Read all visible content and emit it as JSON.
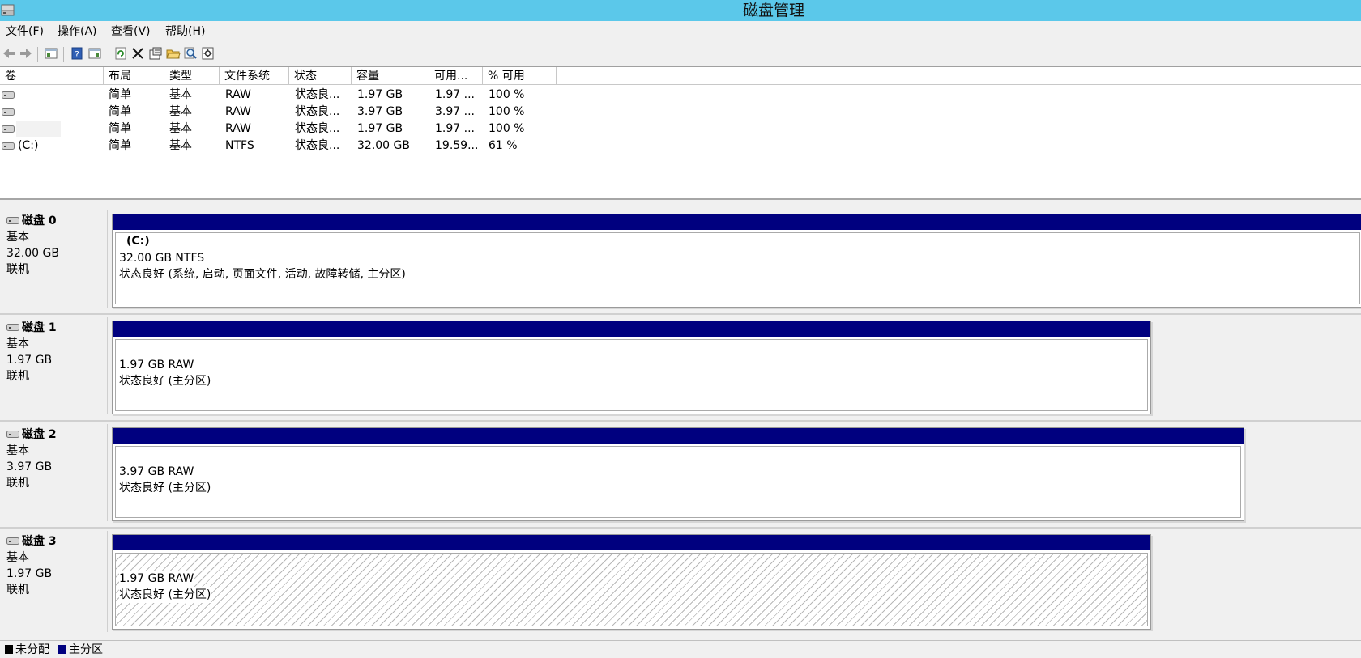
{
  "window": {
    "title": "磁盘管理"
  },
  "menu": {
    "items": [
      "文件(F)",
      "操作(A)",
      "查看(V)",
      "帮助(H)"
    ]
  },
  "toolbar": {
    "icons": [
      "back-arrow-icon",
      "forward-arrow-icon",
      "console-tree-icon",
      "help-icon",
      "properties-view-icon",
      "refresh-icon",
      "delete-icon",
      "properties-icon",
      "open-folder-icon",
      "search-icon",
      "settings-icon"
    ]
  },
  "volume_table": {
    "columns": [
      "卷",
      "布局",
      "类型",
      "文件系统",
      "状态",
      "容量",
      "可用...",
      "% 可用"
    ],
    "rows": [
      {
        "volume": "",
        "layout": "简单",
        "type": "基本",
        "fs": "RAW",
        "status": "状态良...",
        "capacity": "1.97 GB",
        "free": "1.97 ...",
        "pct_free": "100 %"
      },
      {
        "volume": "",
        "layout": "简单",
        "type": "基本",
        "fs": "RAW",
        "status": "状态良...",
        "capacity": "3.97 GB",
        "free": "3.97 ...",
        "pct_free": "100 %"
      },
      {
        "volume": "",
        "layout": "简单",
        "type": "基本",
        "fs": "RAW",
        "status": "状态良...",
        "capacity": "1.97 GB",
        "free": "1.97 ...",
        "pct_free": "100 %"
      },
      {
        "volume": "(C:)",
        "layout": "简单",
        "type": "基本",
        "fs": "NTFS",
        "status": "状态良...",
        "capacity": "32.00 GB",
        "free": "19.59...",
        "pct_free": "61 %"
      }
    ]
  },
  "disks": [
    {
      "name": "磁盘 0",
      "type": "基本",
      "size": "32.00 GB",
      "state": "联机",
      "partition": {
        "label": "(C:)",
        "size_fs": "32.00 GB NTFS",
        "status": "状态良好 (系统, 启动, 页面文件, 活动, 故障转储, 主分区)"
      }
    },
    {
      "name": "磁盘 1",
      "type": "基本",
      "size": "1.97 GB",
      "state": "联机",
      "partition": {
        "label": "",
        "size_fs": "1.97 GB RAW",
        "status": "状态良好 (主分区)"
      }
    },
    {
      "name": "磁盘 2",
      "type": "基本",
      "size": "3.97 GB",
      "state": "联机",
      "partition": {
        "label": "",
        "size_fs": "3.97 GB RAW",
        "status": "状态良好 (主分区)"
      }
    },
    {
      "name": "磁盘 3",
      "type": "基本",
      "size": "1.97 GB",
      "state": "联机",
      "partition": {
        "label": "",
        "size_fs": "1.97 GB RAW",
        "status": "状态良好 (主分区)",
        "selected": true
      }
    }
  ],
  "legend": [
    {
      "label": "未分配",
      "color": "#000000"
    },
    {
      "label": "主分区",
      "color": "#00007f"
    }
  ],
  "colors": {
    "title_bar": "#5bc8ea",
    "primary_partition": "#00007f"
  }
}
